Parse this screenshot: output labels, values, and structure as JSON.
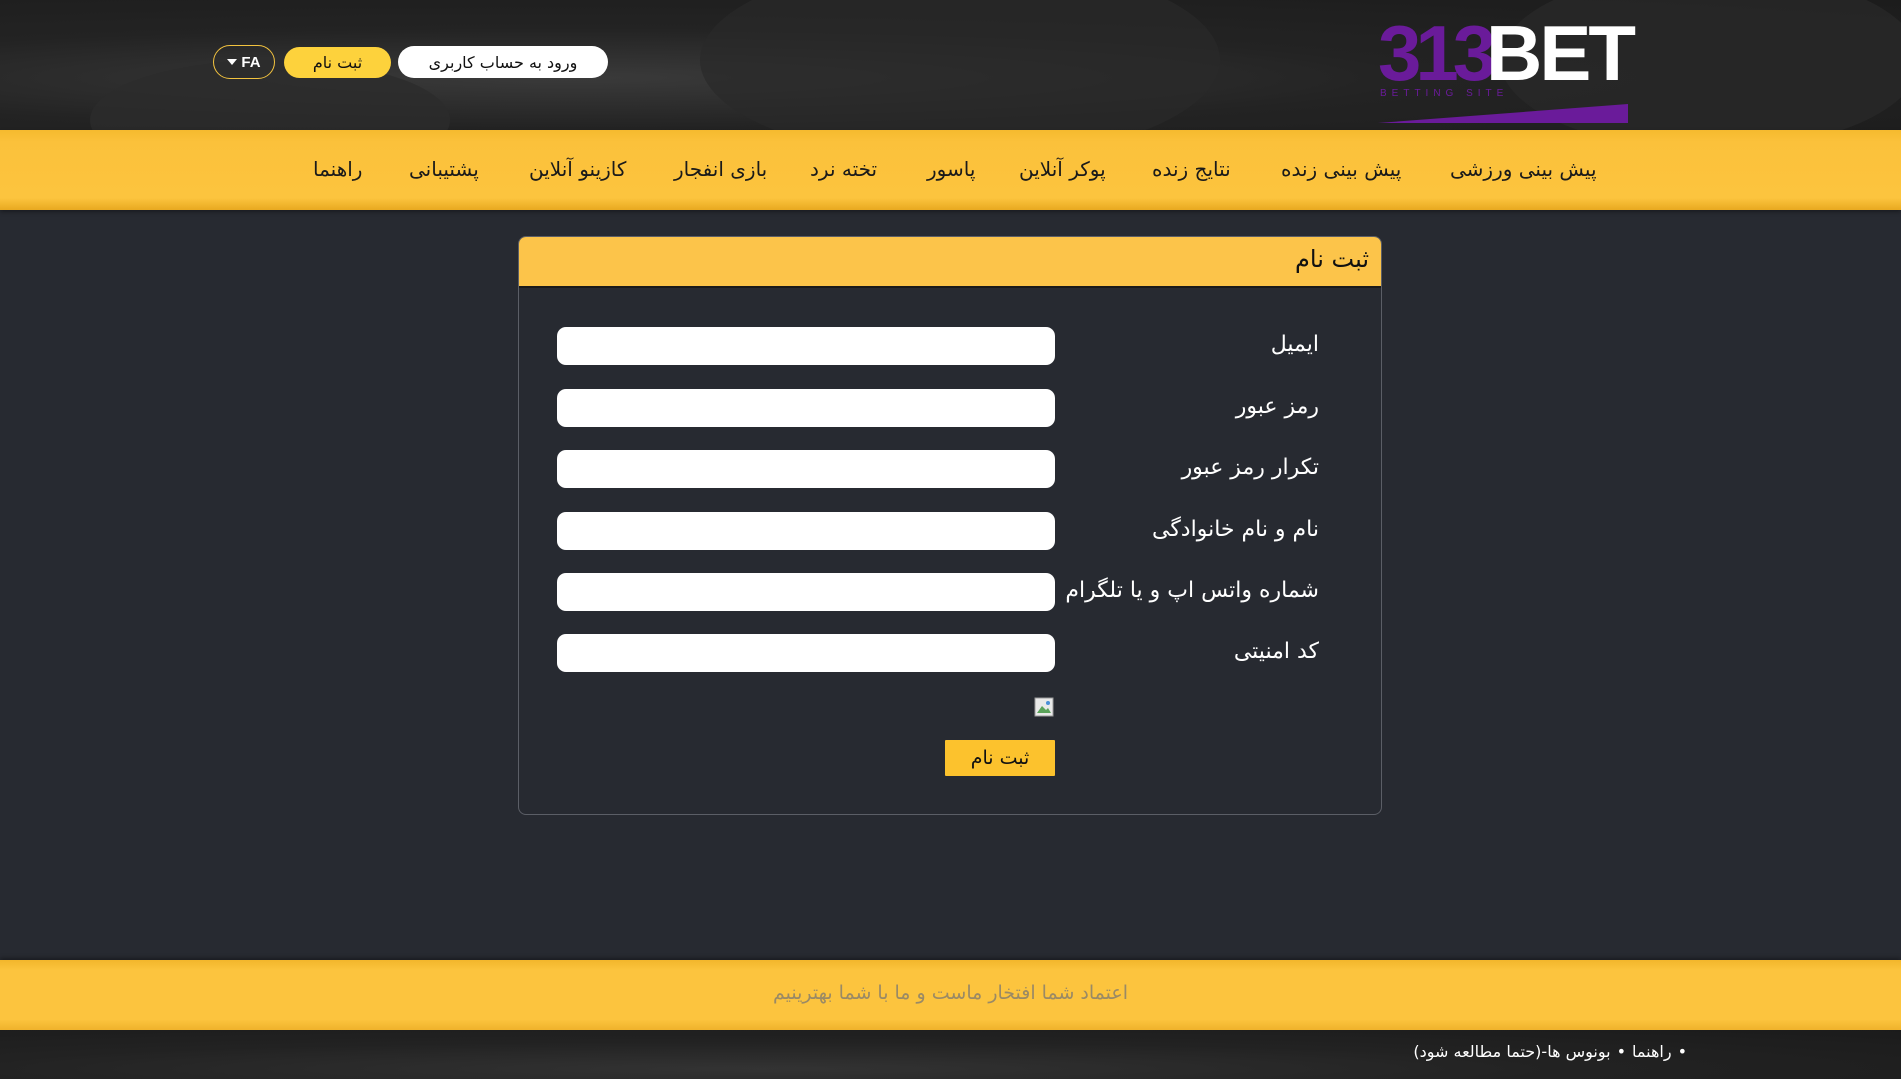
{
  "colors": {
    "accent_yellow": "#fcc43e",
    "brand_purple": "#6a1b9a",
    "page_background": "#272a31"
  },
  "header": {
    "logo": {
      "part1": "313",
      "part2": "BET",
      "subtitle": "BETTING SITE"
    },
    "login_label": "ورود به حساب کاربری",
    "register_label": "ثبت نام",
    "language": {
      "label": "FA",
      "icon": "caret-down-icon"
    }
  },
  "nav": {
    "items": [
      {
        "label": "پیش بینی ورزشی"
      },
      {
        "label": "پیش بینی زنده"
      },
      {
        "label": "نتایج زنده"
      },
      {
        "label": "پوکر آنلاین"
      },
      {
        "label": "پاسور"
      },
      {
        "label": "تخته نرد"
      },
      {
        "label": "بازی انفجار"
      },
      {
        "label": "کازینو آنلاین"
      },
      {
        "label": "پشتیبانی"
      },
      {
        "label": "راهنما"
      }
    ]
  },
  "form": {
    "title": "ثبت نام",
    "fields": [
      {
        "label": "ایمیل",
        "value": ""
      },
      {
        "label": "رمز عبور",
        "value": ""
      },
      {
        "label": "تکرار رمز عبور",
        "value": ""
      },
      {
        "label": "نام و نام خانوادگی",
        "value": ""
      },
      {
        "label": "شماره واتس اپ و یا تلگرام",
        "value": ""
      },
      {
        "label": "کد امنیتی",
        "value": ""
      }
    ],
    "captcha_icon": "broken-image-icon",
    "submit_label": "ثبت نام"
  },
  "footer": {
    "tagline": "اعتماد شما افتخار ماست و ما با شما بهترینیم",
    "links": [
      {
        "bullet": "•",
        "label": "راهنما"
      },
      {
        "bullet": "•",
        "label": "بونوس ها-(حتما مطالعه شود)"
      }
    ]
  }
}
